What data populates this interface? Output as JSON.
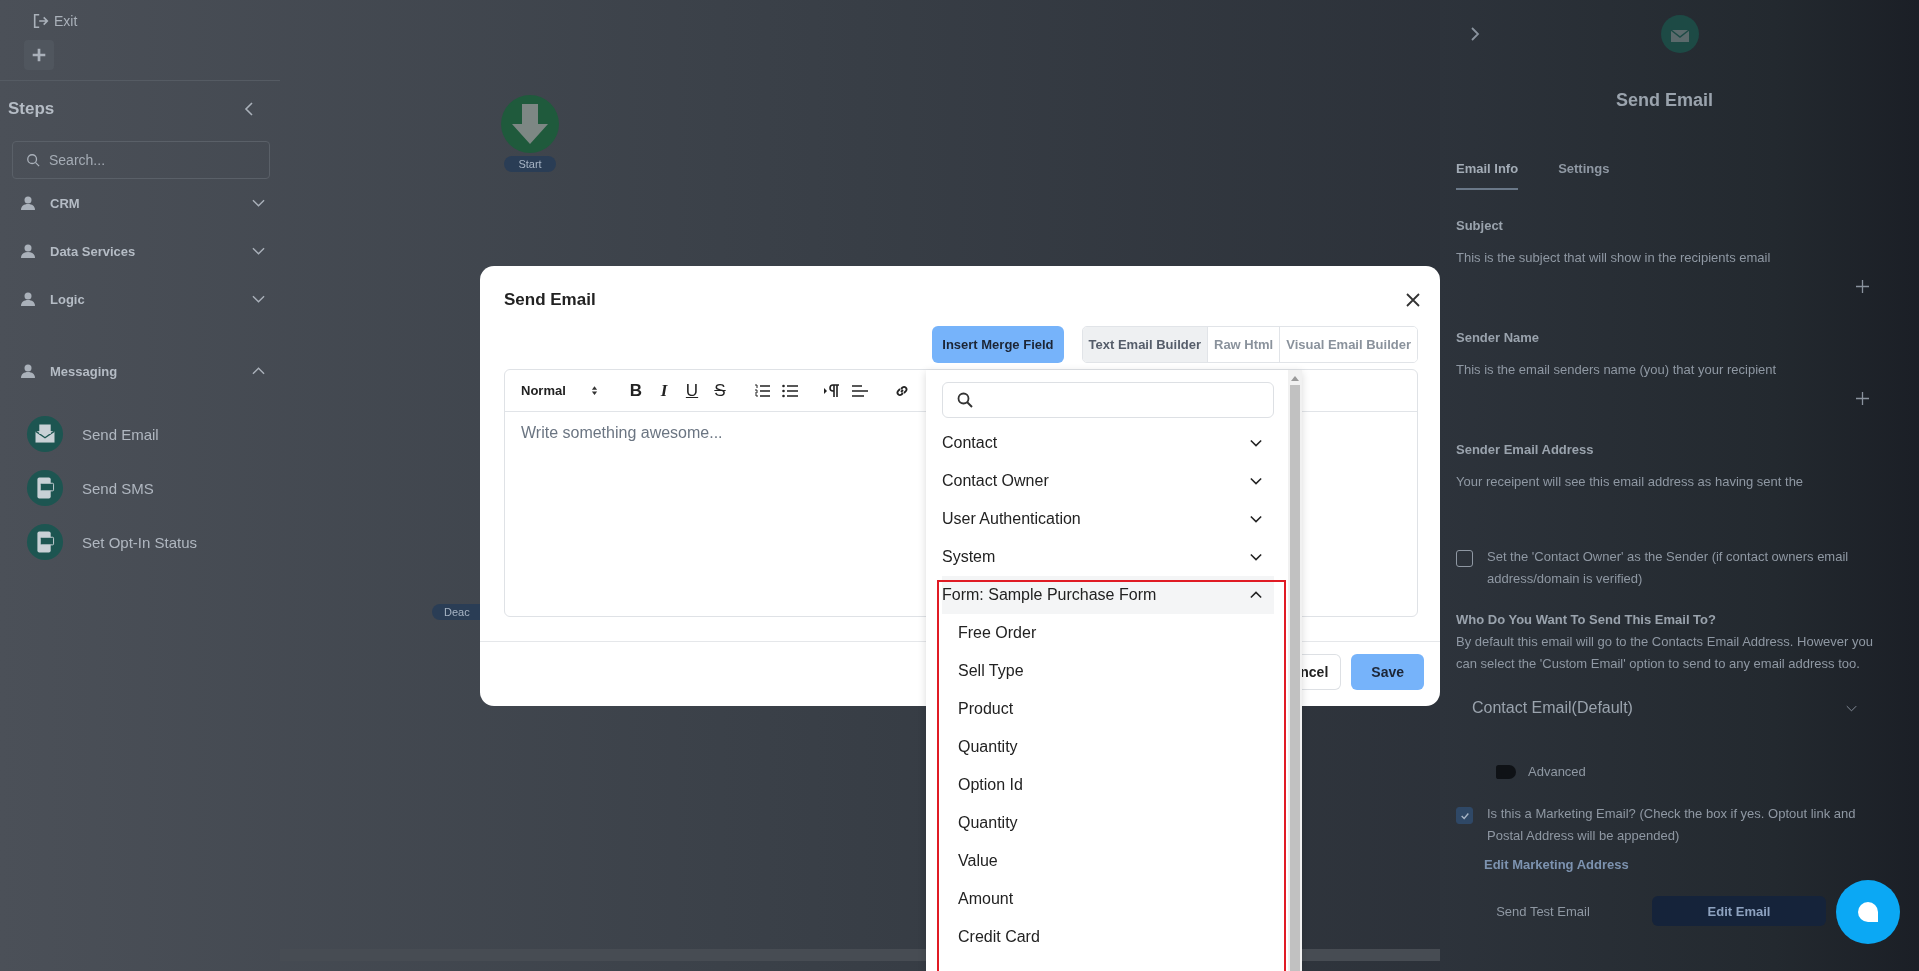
{
  "topbar": {
    "exit_label": "Exit"
  },
  "sidebar": {
    "title": "Steps",
    "search": {
      "placeholder": "Search..."
    },
    "categories": [
      {
        "label": "CRM",
        "expanded": false
      },
      {
        "label": "Data Services",
        "expanded": false
      },
      {
        "label": "Logic",
        "expanded": false
      },
      {
        "label": "Messaging",
        "expanded": true,
        "children": [
          {
            "label": "Send Email",
            "kind": "email"
          },
          {
            "label": "Send SMS",
            "kind": "sms"
          },
          {
            "label": "Set Opt-In Status",
            "kind": "sms"
          }
        ]
      }
    ]
  },
  "canvas": {
    "start_label": "Start",
    "status_label": "Deac"
  },
  "panel": {
    "title": "Send Email",
    "tabs": [
      {
        "label": "Email Info",
        "selected": true
      },
      {
        "label": "Settings",
        "selected": false
      }
    ],
    "fields": [
      {
        "label": "Subject",
        "description": "This is the subject that will show in the recipients email"
      },
      {
        "label": "Sender Name",
        "description": "This is the email senders name (you) that your recipient"
      },
      {
        "label": "Sender Email Address",
        "description": "Your receipent will see this email address as having sent the"
      }
    ],
    "owner_checkbox": {
      "label": "Set the 'Contact Owner' as the Sender (if contact owners email address/domain is verified)",
      "checked": false
    },
    "recipient": {
      "title": "Who Do You Want To Send This Email To?",
      "description": "By default this email will go to the Contacts Email Address. However you can select the 'Custom Email' option to send to any email address too.",
      "value": "Contact Email(Default)"
    },
    "advanced": {
      "label": "Advanced",
      "on": false
    },
    "marketing_checkbox": {
      "label": "Is this a Marketing Email? (Check the box if yes. Optout link and Postal Address will be appended)",
      "checked": true
    },
    "marketing_link": "Edit Marketing Address",
    "buttons": [
      "Send Test Email",
      "Edit Email"
    ]
  },
  "modal": {
    "title": "Send Email",
    "merge_button": "Insert Merge Field",
    "builder_tabs": [
      {
        "label": "Text Email Builder",
        "selected": true
      },
      {
        "label": "Raw Html",
        "selected": false
      },
      {
        "label": "Visual Email Builder",
        "selected": false
      }
    ],
    "format": "Normal",
    "toolbar": [
      {
        "kind": "bold",
        "text": "B"
      },
      {
        "kind": "italic",
        "text": "I"
      },
      {
        "kind": "underline",
        "text": "U"
      },
      {
        "kind": "strike",
        "text": "S"
      },
      {
        "kind": "ordered"
      },
      {
        "kind": "bullet"
      },
      {
        "kind": "direction"
      },
      {
        "kind": "align"
      },
      {
        "kind": "link"
      }
    ],
    "editor": {
      "placeholder": "Write something awesome..."
    },
    "cancel": "ncel",
    "save": "Save"
  },
  "merge_menu": {
    "groups": [
      {
        "label": "Contact",
        "expanded": false
      },
      {
        "label": "Contact Owner",
        "expanded": false
      },
      {
        "label": "User Authentication",
        "expanded": false
      },
      {
        "label": "System",
        "expanded": false
      },
      {
        "label": "Form: Sample Purchase Form",
        "expanded": true,
        "children": [
          {
            "label": "Free Order"
          },
          {
            "label": "Sell Type"
          },
          {
            "label": "Product"
          },
          {
            "label": "Quantity"
          },
          {
            "label": "Option Id"
          },
          {
            "label": "Quantity"
          },
          {
            "label": "Value"
          },
          {
            "label": "Amount"
          },
          {
            "label": "Credit Card"
          }
        ]
      }
    ]
  }
}
